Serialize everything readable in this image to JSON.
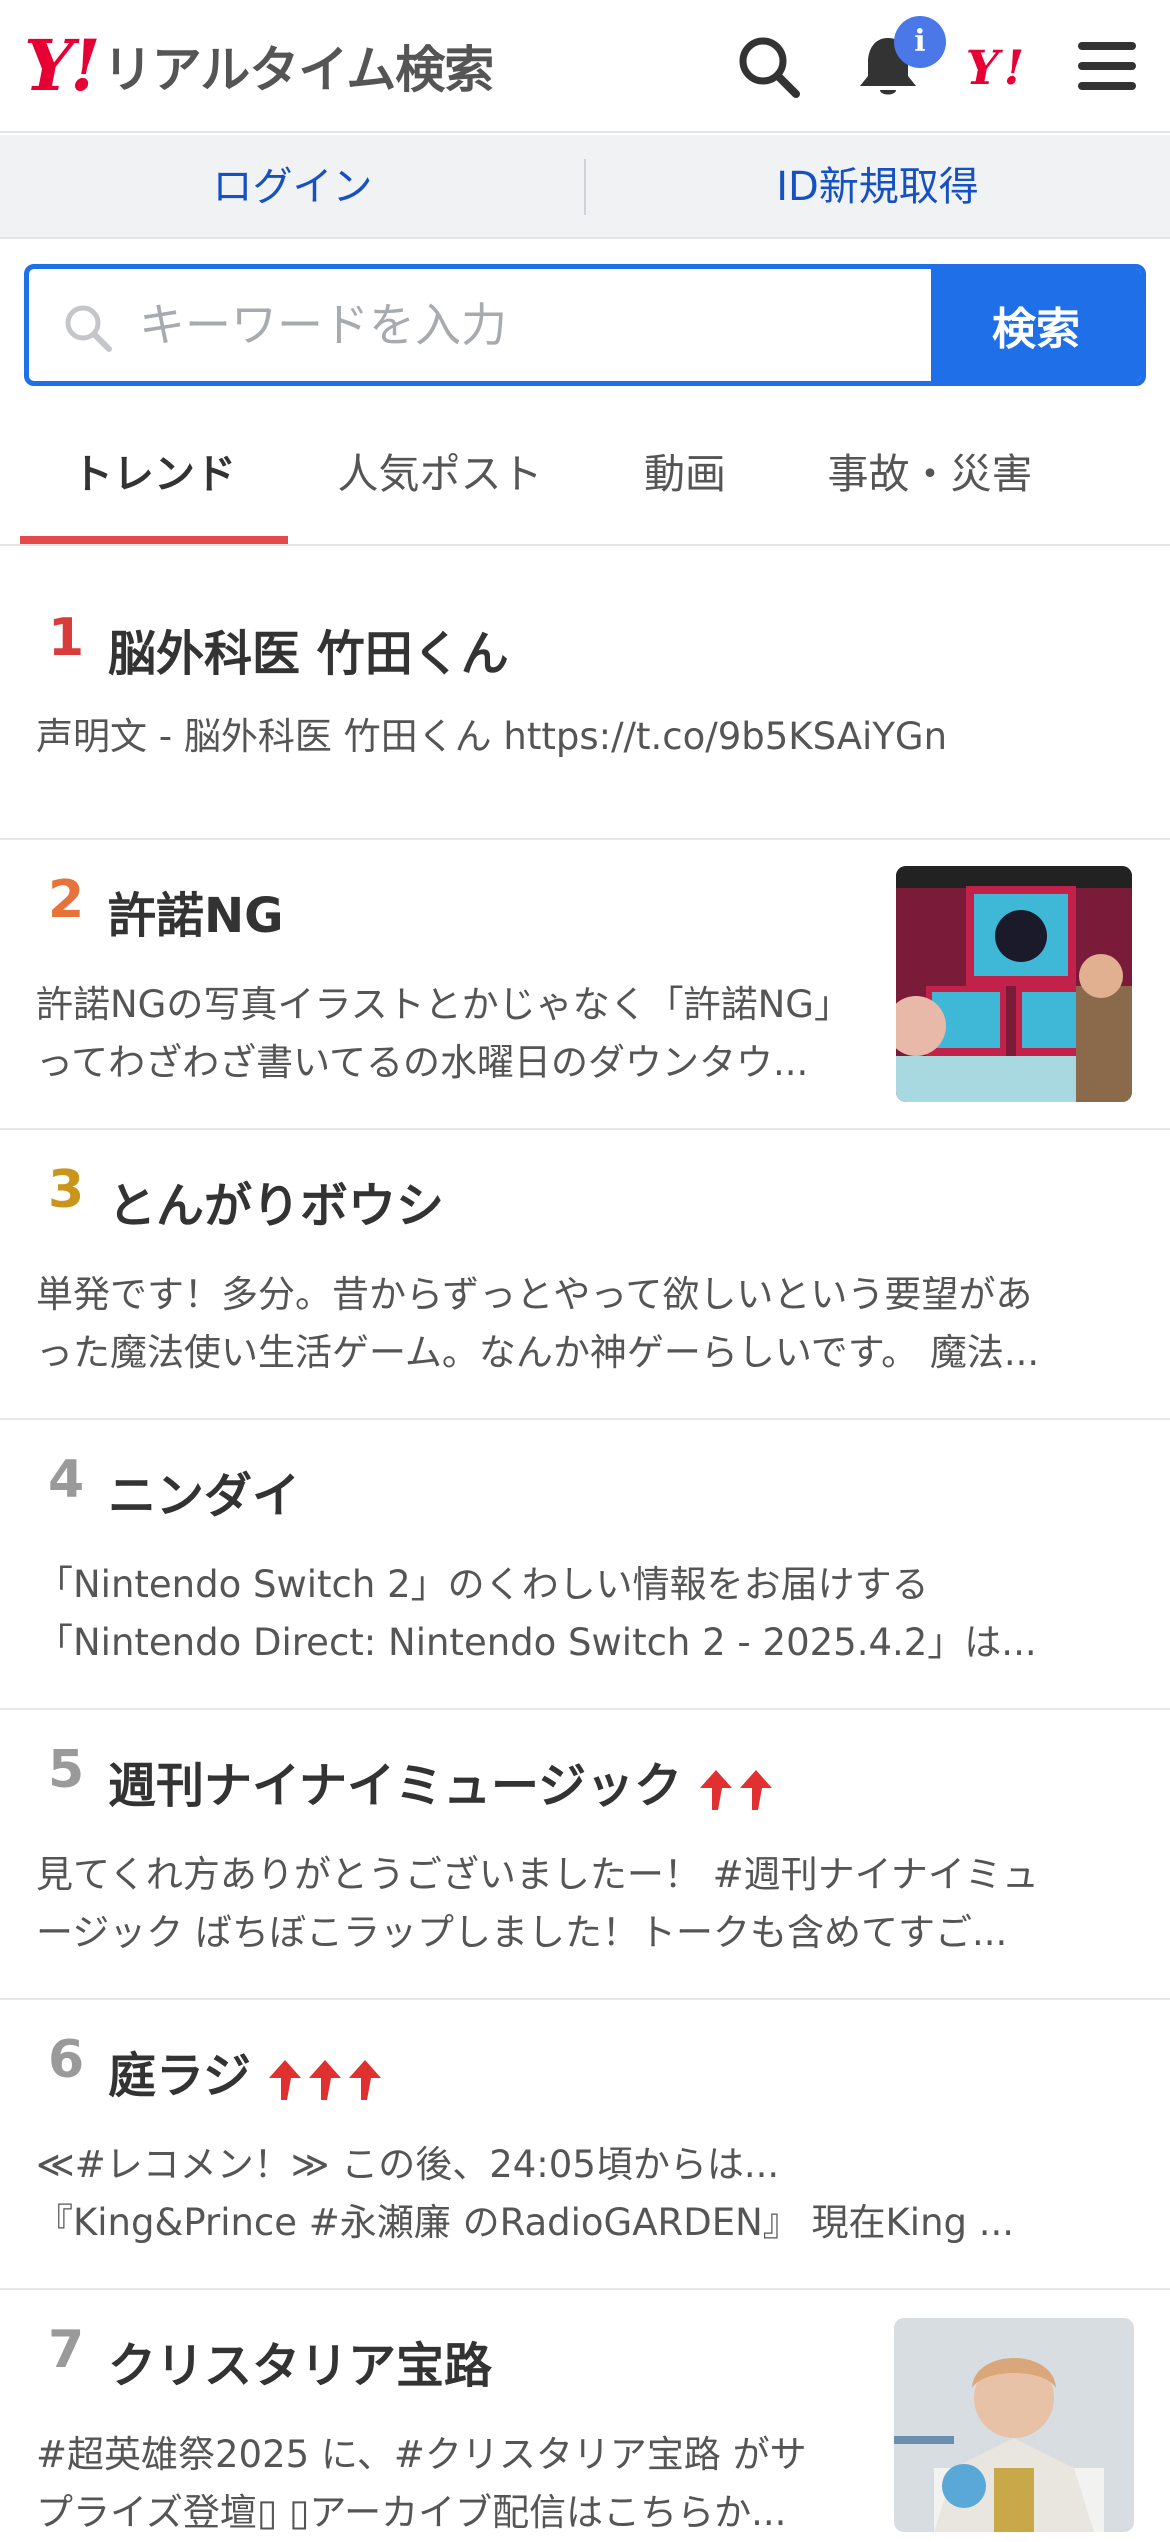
{
  "header": {
    "logo_mark": "Y!",
    "logo_text": "リアルタイム検索",
    "notification_badge": "i",
    "icons": [
      "search-icon",
      "bell-icon",
      "yahoo-japan-icon",
      "menu-icon"
    ]
  },
  "auth": {
    "login": "ログイン",
    "register": "ID新規取得"
  },
  "search": {
    "placeholder": "キーワードを入力",
    "button": "検索"
  },
  "tabs": [
    {
      "label": "トレンド",
      "active": true
    },
    {
      "label": "人気ポスト",
      "active": false
    },
    {
      "label": "動画",
      "active": false
    },
    {
      "label": "事故・災害",
      "active": false
    }
  ],
  "colors": {
    "brand_red": "#e60033",
    "accent_blue": "#1f6fe9",
    "rank1": "#d93a3a",
    "rank2": "#e8733a",
    "rank3": "#c9961b",
    "rank_other": "#9a9a9a",
    "rising_arrow": "#e03030"
  },
  "trends": [
    {
      "rank": "1",
      "title": "脳外科医 竹田くん",
      "desc": [
        "声明文 - 脳外科医 竹田くん https://t.co/9b5KSAiYGn"
      ],
      "rising_arrows": 0,
      "has_thumb": false
    },
    {
      "rank": "2",
      "title": "許諾NG",
      "desc": [
        "許諾NGの写真イラストとかじゃなく「許諾NG」",
        "ってわざわざ書いてるの水曜日のダウンタウ..."
      ],
      "rising_arrows": 0,
      "has_thumb": true
    },
    {
      "rank": "3",
      "title": "とんがりボウシ",
      "desc": [
        "単発です！多分。昔からずっとやって欲しいという要望があ",
        "った魔法使い生活ゲーム。なんか神ゲーらしいです。 魔法..."
      ],
      "rising_arrows": 0,
      "has_thumb": false
    },
    {
      "rank": "4",
      "title": "ニンダイ",
      "desc": [
        "「Nintendo Switch 2」のくわしい情報をお届けする",
        "「Nintendo Direct: Nintendo Switch 2 - 2025.4.2」は..."
      ],
      "rising_arrows": 0,
      "has_thumb": false
    },
    {
      "rank": "5",
      "title": "週刊ナイナイミュージック",
      "desc": [
        "見てくれ方ありがとうございましたー！ #週刊ナイナイミュ",
        "ージック ばちぼこラップしました！トークも含めてすご..."
      ],
      "rising_arrows": 2,
      "has_thumb": false
    },
    {
      "rank": "6",
      "title": "庭ラジ",
      "desc": [
        "≪#レコメン！≫ この後、24:05頃からは...",
        "『King&Prince #永瀬廉 のRadioGARDEN』 現在King ..."
      ],
      "rising_arrows": 3,
      "has_thumb": false
    },
    {
      "rank": "7",
      "title": "クリスタリア宝路",
      "desc": [
        "#超英雄祭2025 に、#クリスタリア宝路 がサ",
        "プライズ登壇▯ ▯アーカイブ配信はこちらか..."
      ],
      "rising_arrows": 0,
      "has_thumb": true
    }
  ]
}
